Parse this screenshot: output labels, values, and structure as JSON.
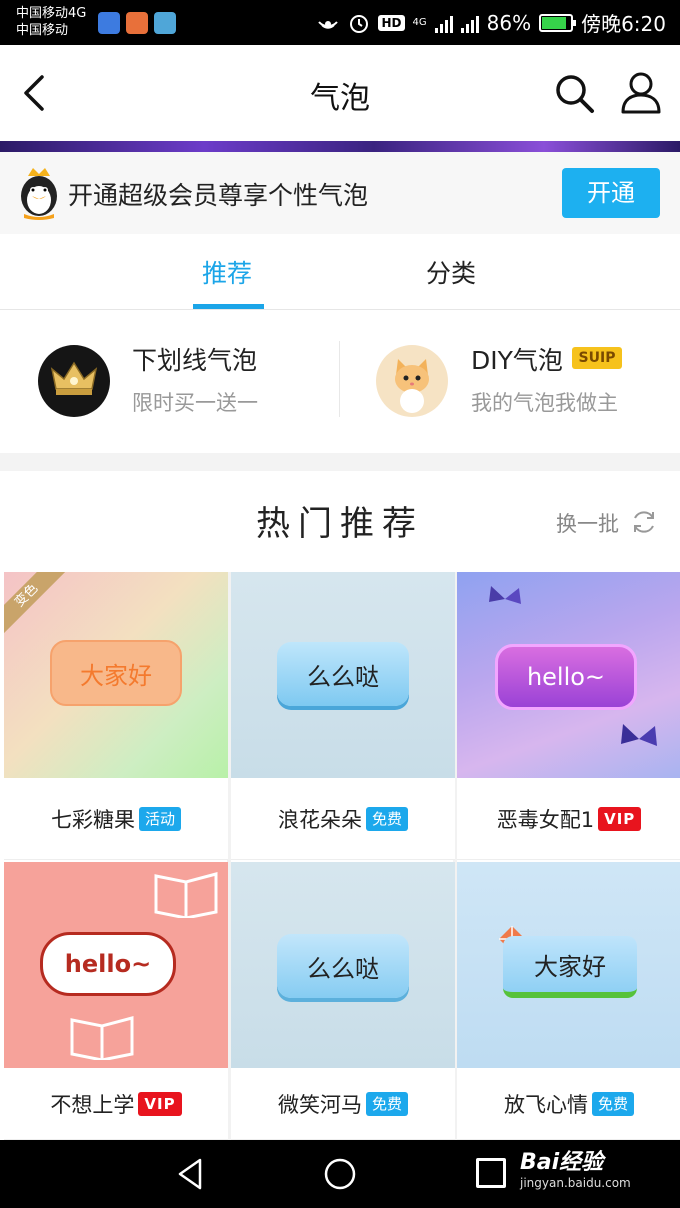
{
  "status_bar": {
    "carrier_1": "中国移动4G",
    "carrier_2": "中国移动",
    "hd": "HD",
    "net_4g": "4G",
    "battery_pct": "86%",
    "time": "傍晚6:20"
  },
  "nav": {
    "title": "气泡"
  },
  "vip_promo": {
    "text": "开通超级会员尊享个性气泡",
    "button": "开通"
  },
  "tabs": [
    {
      "label": "推荐",
      "active": true
    },
    {
      "label": "分类",
      "active": false
    }
  ],
  "features": [
    {
      "title": "下划线气泡",
      "subtitle": "限时买一送一"
    },
    {
      "title": "DIY气泡",
      "badge": "SUIP",
      "subtitle": "我的气泡我做主"
    }
  ],
  "hot": {
    "title": "热门推荐",
    "refresh": "换一批"
  },
  "cards": [
    {
      "name": "七彩糖果",
      "badge": "活动",
      "badge_type": "blue",
      "bubble_text": "大家好",
      "corner": "变色"
    },
    {
      "name": "浪花朵朵",
      "badge": "免费",
      "badge_type": "blue",
      "bubble_text": "么么哒"
    },
    {
      "name": "恶毒女配1",
      "badge": "VIP",
      "badge_type": "red",
      "bubble_text": "hello~"
    },
    {
      "name": "不想上学",
      "badge": "VIP",
      "badge_type": "red",
      "bubble_text": "hello~"
    },
    {
      "name": "微笑河马",
      "badge": "免费",
      "badge_type": "blue",
      "bubble_text": "么么哒"
    },
    {
      "name": "放飞心情",
      "badge": "免费",
      "badge_type": "blue",
      "bubble_text": "大家好"
    }
  ],
  "watermark": {
    "logo": "Bai经验",
    "url": "jingyan.baidu.com"
  },
  "colors": {
    "accent": "#1ba5e8",
    "vip_red": "#e8141e",
    "suip_gold": "#f6c21c"
  }
}
